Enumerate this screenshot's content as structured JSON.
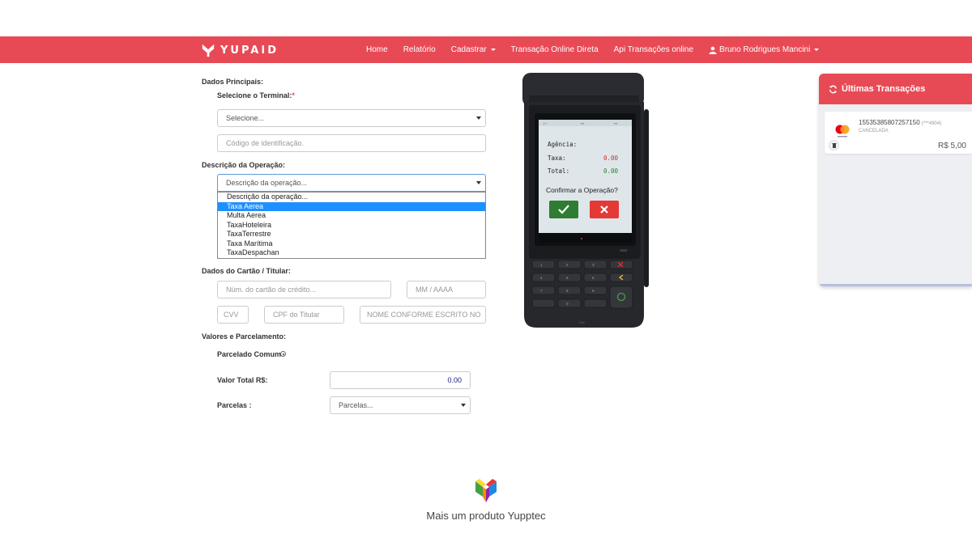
{
  "navbar": {
    "brand": "YUPAID",
    "items": [
      "Home",
      "Relatório",
      "Cadastrar",
      "Transação Online Direta",
      "Api Transações online"
    ],
    "user": "Bruno Rodrigues Mancini"
  },
  "form": {
    "section_main": "Dados Principais:",
    "terminal_label": "Selecione o Terminal:",
    "terminal_required": "*",
    "terminal_value": "Selecione...",
    "id_code_placeholder": "Código de identificação.",
    "operation_label": "Descrição da Operação:",
    "operation_value": "Descrição da operação...",
    "operation_options": [
      "Descrição da operação...",
      "Taxa Aerea",
      "Multa Aerea",
      "TaxaHoteleira",
      "TaxaTerrestre",
      "Taxa Marítima",
      "TaxaDespachan"
    ],
    "operation_selected_index": 1,
    "card_section": "Dados do Cartão / Titular:",
    "card_number_placeholder": "Núm. do cartão de crédito...",
    "expiry_placeholder": "MM / AAAA",
    "cvv_placeholder": "CVV",
    "cpf_placeholder": "CPF do Titular",
    "name_placeholder": "NOME CONFORME ESCRITO NO",
    "values_section": "Valores e Parcelamento:",
    "installment_type": "Parcelado Comum",
    "total_label": "Valor Total R$:",
    "total_value": "0.00",
    "installments_label": "Parcelas :",
    "installments_value": "Parcelas..."
  },
  "pos_screen": {
    "agency_label": "Agência:",
    "fee_label": "Taxa:",
    "fee_value": "0.00",
    "total_label": "Total:",
    "total_value": "0.00",
    "confirm_text": "Confirmar a Operação?"
  },
  "transactions": {
    "title": "Últimas Transações",
    "items": [
      {
        "id": "15535385807257150",
        "mask": "(***4904)",
        "status": "CANCELADA",
        "amount": "R$ 5,00"
      }
    ]
  },
  "footer": {
    "text": "Mais um produto Yupptec"
  },
  "colors": {
    "brand_red": "#e84a55",
    "selected_option": "#1e90ff"
  }
}
